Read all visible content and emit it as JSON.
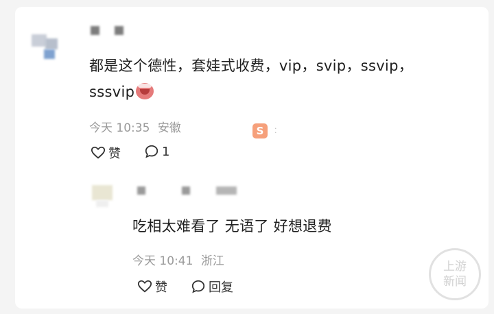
{
  "comment": {
    "text_line1": "都是这个德性，套娃式收费，vip，svip，ssvip，",
    "text_line2": "sssvip",
    "time": "今天 10:35",
    "location": "安徽",
    "like_label": "赞",
    "comment_count": "1",
    "sticker_letter": "S"
  },
  "reply": {
    "text": "吃相太难看了 无语了 好想退费",
    "time": "今天 10:41",
    "location": "浙江",
    "like_label": "赞",
    "reply_label": "回复"
  },
  "watermark": {
    "line1": "上游",
    "line2": "新闻"
  },
  "colors": {
    "sticker": "#f08a5d",
    "meta_text": "#9a9a9a"
  }
}
